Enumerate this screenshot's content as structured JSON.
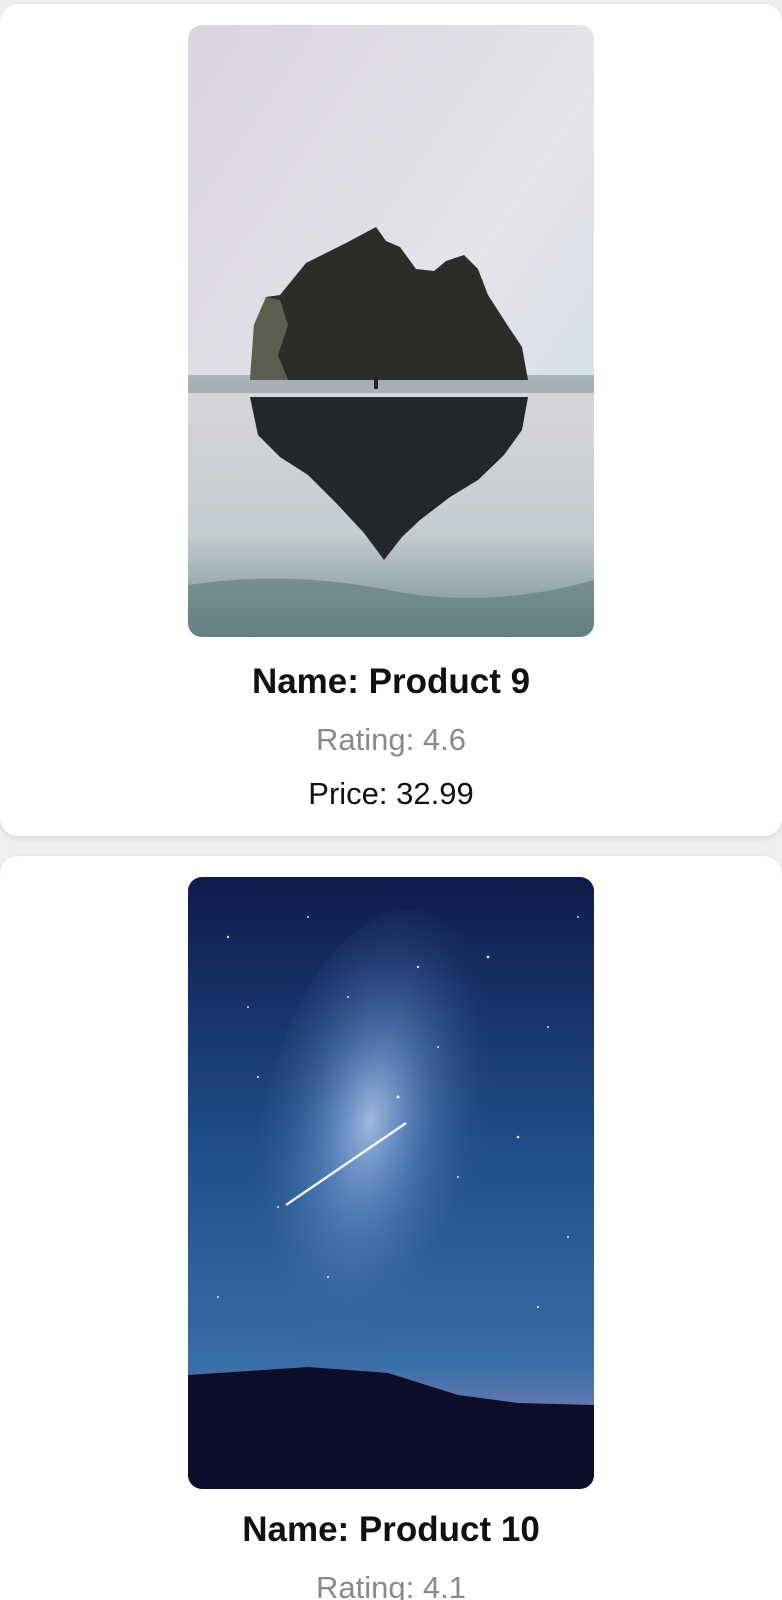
{
  "products": [
    {
      "name": "Name: Product 9",
      "rating": "Rating: 4.6",
      "price": "Price: 32.99",
      "image": "sea-stack-reflection-photo"
    },
    {
      "name": "Name: Product 10",
      "rating": "Rating: 4.1",
      "image": "milky-way-night-sky-photo"
    }
  ],
  "colors": {
    "card_background": "#ffffff",
    "page_background": "#efefef",
    "name_text": "#111111",
    "rating_text": "#8a8a8a",
    "price_text": "#111111"
  }
}
